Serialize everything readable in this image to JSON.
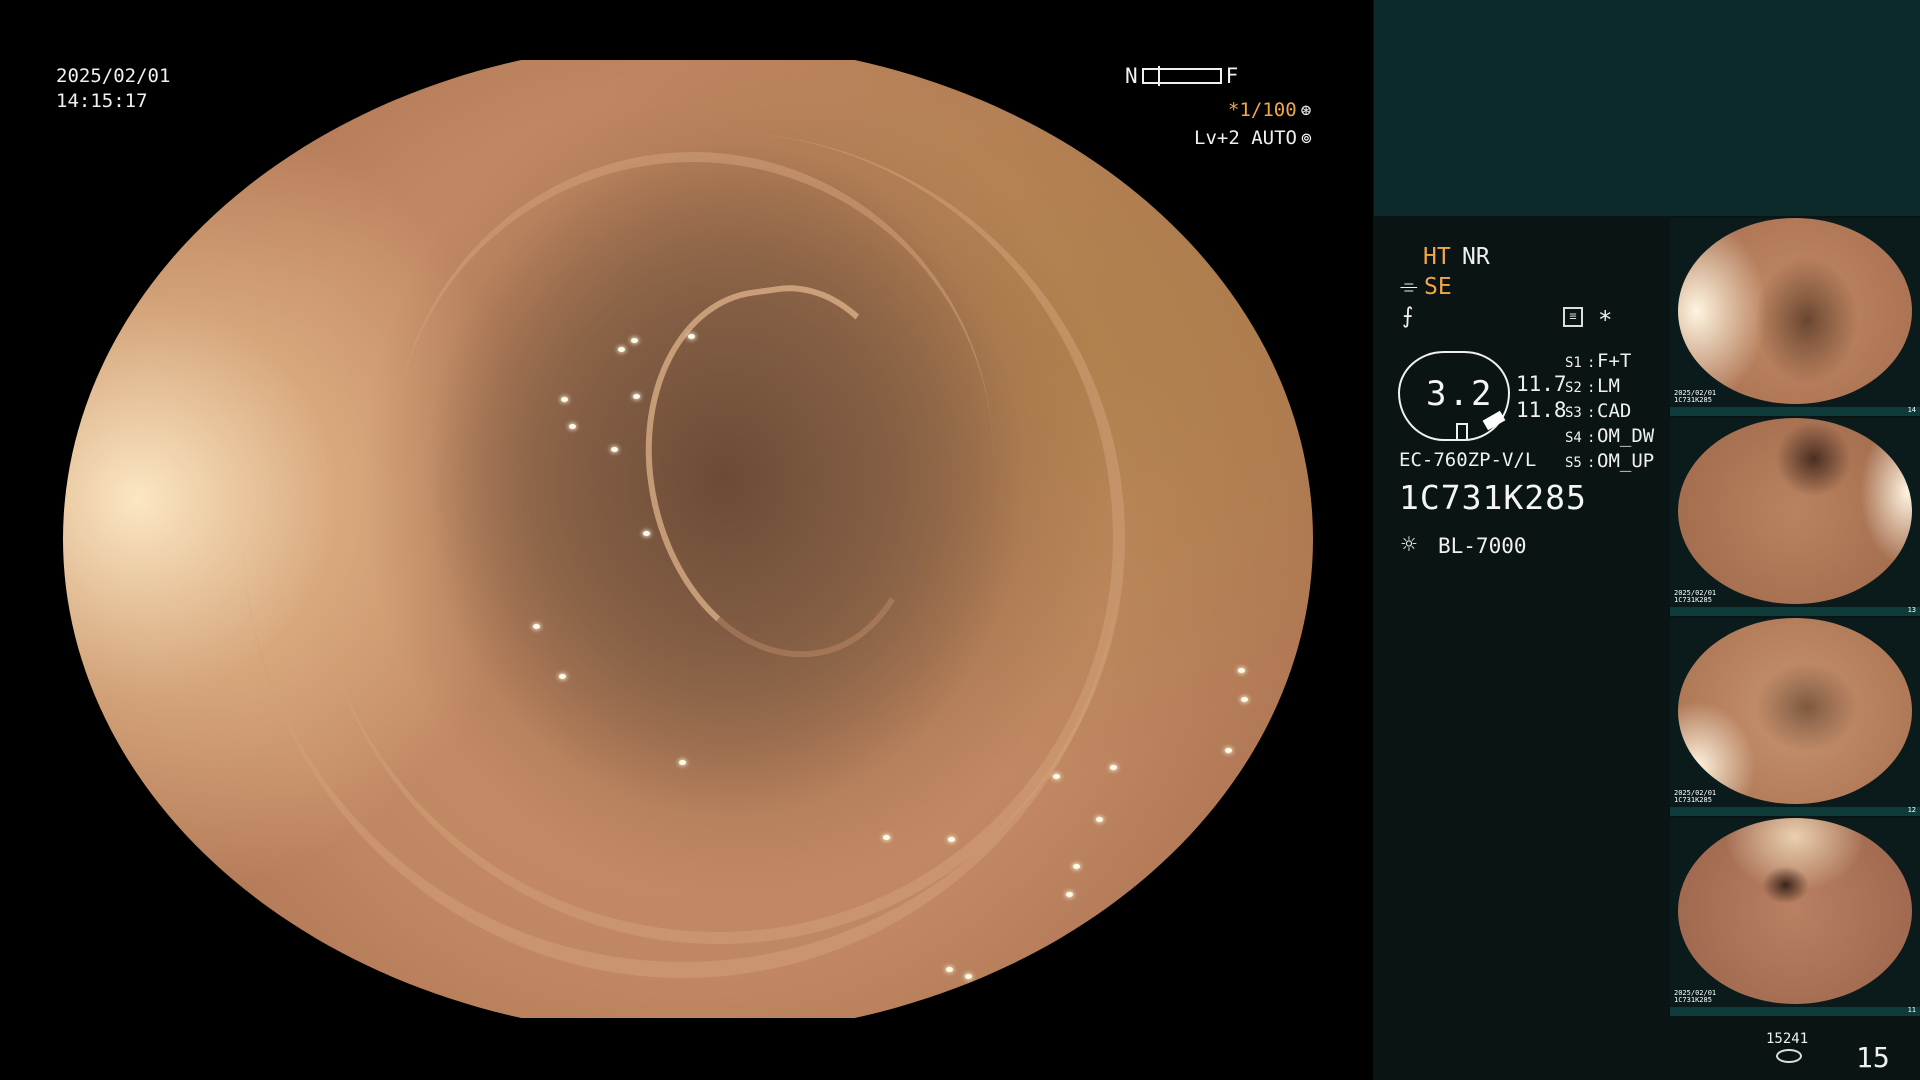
{
  "colors": {
    "accent": "#f2a744",
    "panel_background": "#0a1414",
    "panel_top": "#0d2a2b",
    "text": "#f0f0f0"
  },
  "overlay": {
    "date": "2025/02/01",
    "time": "14:15:17",
    "near_label": "N",
    "far_label": "F",
    "shutter": "*1/100",
    "shutter_icon": "aperture-icon",
    "iris": "Lv+2 AUTO",
    "iris_icon": "iris-auto-icon"
  },
  "panel": {
    "mode_ht": "HT",
    "mode_nr": "NR",
    "mode_se_icon": "⌯",
    "mode_se": "SE",
    "fn_icon": "⨍",
    "scale_value": "3.2",
    "value_a": "11.7",
    "value_b": "11.8",
    "scope_model": "EC-760ZP-V/L",
    "serial": "1C731K285",
    "light_model": "BL-7000",
    "presets": [
      {
        "key": "S1",
        "value": "F+T"
      },
      {
        "key": "S2",
        "value": "LM"
      },
      {
        "key": "S3",
        "value": "CAD"
      },
      {
        "key": "S4",
        "value": "OM_DW"
      },
      {
        "key": "S5",
        "value": "OM_UP"
      }
    ]
  },
  "thumbnails": [
    {
      "label_date": "2025/02/01",
      "label_serial": "1C731K285",
      "number": "14"
    },
    {
      "label_date": "2025/02/01",
      "label_serial": "1C731K285",
      "number": "13"
    },
    {
      "label_date": "2025/02/01",
      "label_serial": "1C731K285",
      "number": "12"
    },
    {
      "label_date": "2025/02/01",
      "label_serial": "1C731K285",
      "number": "11"
    }
  ],
  "footer": {
    "count": "15241",
    "page": "15"
  }
}
